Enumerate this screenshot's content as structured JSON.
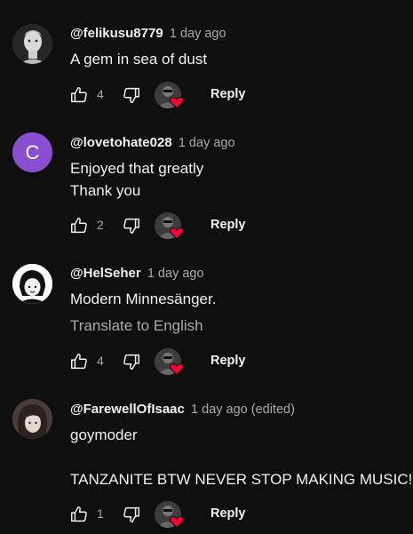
{
  "comments": [
    {
      "handle": "@felikusu8779",
      "time": "1 day ago",
      "lines": [
        "A gem in sea of dust"
      ],
      "likes": "4",
      "reply_label": "Reply",
      "avatar_type": "statue"
    },
    {
      "handle": "@lovetohate028",
      "time": "1 day ago",
      "lines": [
        "Enjoyed that greatly",
        "Thank you"
      ],
      "likes": "2",
      "reply_label": "Reply",
      "avatar_type": "letter",
      "avatar_letter": "C",
      "avatar_color": "#8a4fd0"
    },
    {
      "handle": "@HelSeher",
      "time": "1 day ago",
      "lines": [
        "Modern Minnesänger."
      ],
      "translate_label": "Translate to English",
      "likes": "4",
      "reply_label": "Reply",
      "avatar_type": "face"
    },
    {
      "handle": "@FarewellOfIsaac",
      "time": "1 day ago (edited)",
      "lines": [
        "goymoder",
        "",
        "TANZANITE BTW NEVER STOP MAKING MUSIC!"
      ],
      "likes": "1",
      "reply_label": "Reply",
      "avatar_type": "photo"
    }
  ],
  "icons": {
    "like": "thumbs-up-icon",
    "dislike": "thumbs-down-icon",
    "creator_heart": "creator-heart-icon"
  },
  "colors": {
    "background": "#0f0f0f",
    "text": "#f1f1f1",
    "secondary_text": "#aaaaaa",
    "heart": "#ff0033"
  }
}
